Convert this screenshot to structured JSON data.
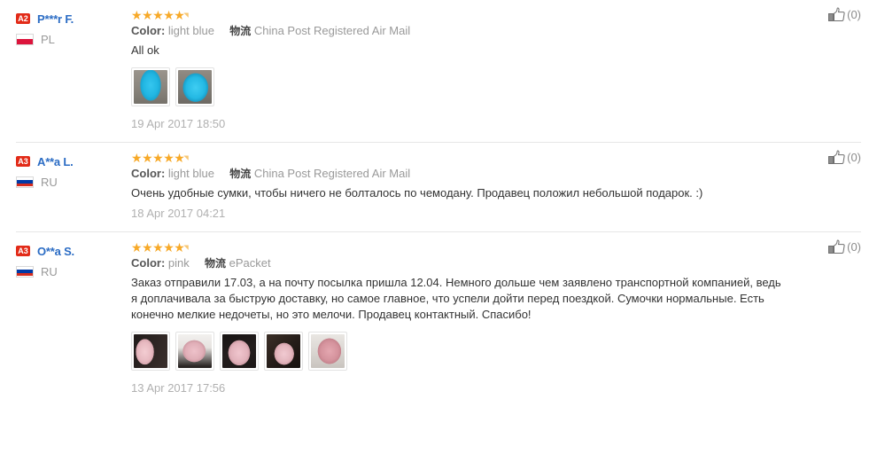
{
  "reviews": [
    {
      "level_badge": "A2",
      "user_name": "P***r F.",
      "country_code": "PL",
      "country_flag": "flag-pl",
      "rating": 5,
      "color_label": "Color:",
      "color_value": "light blue",
      "shipping_label": "物流",
      "shipping_value": "China Post Registered Air Mail",
      "text": "All ok",
      "date": "19 Apr 2017 18:50",
      "helpful_count": "(0)",
      "photos": [
        "ph-blue1",
        "ph-blue2"
      ]
    },
    {
      "level_badge": "A3",
      "user_name": "A**a L.",
      "country_code": "RU",
      "country_flag": "flag-ru",
      "rating": 5,
      "color_label": "Color:",
      "color_value": "light blue",
      "shipping_label": "物流",
      "shipping_value": "China Post Registered Air Mail",
      "text": "Очень удобные сумки, чтобы ничего не болталось по чемодану. Продавец положил небольшой подарок. :)",
      "date": "18 Apr 2017 04:21",
      "helpful_count": "(0)",
      "photos": []
    },
    {
      "level_badge": "A3",
      "user_name": "O**a S.",
      "country_code": "RU",
      "country_flag": "flag-ru",
      "rating": 5,
      "color_label": "Color:",
      "color_value": "pink",
      "shipping_label": "物流",
      "shipping_value": "ePacket",
      "text": "Заказ отправили 17.03, а на почту посылка пришла 12.04. Немного дольше чем заявлено транспортной компанией, ведь я доплачивала за быструю доставку, но самое главное, что успели дойти перед поездкой. Сумочки нормальные. Есть конечно мелкие недочеты, но это мелочи. Продавец контактный. Спасибо!",
      "date": "13 Apr 2017 17:56",
      "helpful_count": "(0)",
      "photos": [
        "ph-pink1",
        "ph-pink2",
        "ph-pink3",
        "ph-pink4",
        "ph-pink5"
      ]
    }
  ],
  "icons": {
    "star_glyph": "★",
    "star_tail_glyph": "◥",
    "thumbs_up": "thumbs-up-icon"
  },
  "colors": {
    "badge_red": "#e22b18",
    "username_blue": "#2b6cc4",
    "star_orange": "#f7a928",
    "muted_gray": "#999999",
    "date_gray": "#b0b0b0",
    "divider": "#e6e6e6"
  }
}
